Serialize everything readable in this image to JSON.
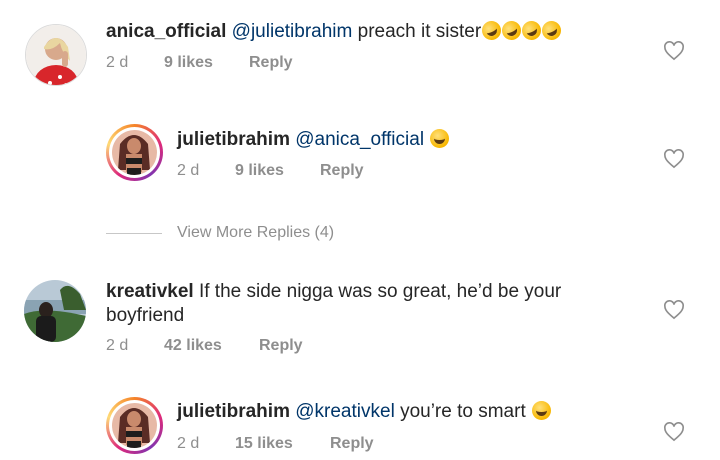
{
  "comments": [
    {
      "username": "anica_official",
      "mention": "@julietibrahim",
      "text": "preach it sister",
      "emojis": 4,
      "time": "2 d",
      "likes": "9 likes",
      "reply": "Reply"
    },
    {
      "username": "julietibrahim",
      "mention": "@anica_official",
      "text": "",
      "emojis": 1,
      "time": "2 d",
      "likes": "9 likes",
      "reply": "Reply"
    },
    {
      "username": "kreativkel",
      "text_line1": "If the side nigga was so great, he’d be your",
      "text_line2": "boyfriend",
      "time": "2 d",
      "likes": "42 likes",
      "reply": "Reply"
    },
    {
      "username": "julietibrahim",
      "mention": "@kreativkel",
      "text": "you’re to smart",
      "emojis": 1,
      "time": "2 d",
      "likes": "15 likes",
      "reply": "Reply"
    }
  ],
  "view_more": "View More Replies (4)",
  "icons": {
    "emoji": "face-with-tears-of-joy-icon",
    "like": "heart-outline-icon"
  },
  "colors": {
    "mention": "#003569",
    "meta": "#8e8e8e",
    "text": "#262626"
  }
}
